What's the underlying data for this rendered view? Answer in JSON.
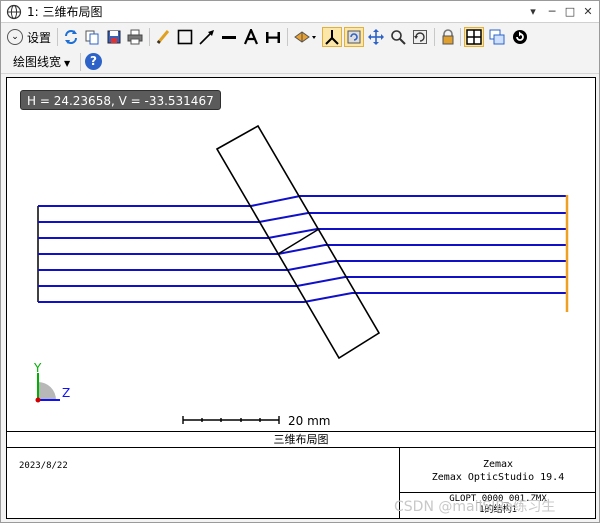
{
  "window": {
    "title": "1: 三维布局图",
    "controls": [
      "▾",
      "□",
      "✕"
    ]
  },
  "toolbar": {
    "settings_label": "设置",
    "line_width_label": "绘图线宽"
  },
  "plot": {
    "coordinate_readout": "H = 24.23658, V = -33.531467",
    "scale_label": "20 mm",
    "axis_labels": {
      "y": "Y",
      "z": "Z"
    },
    "colors": {
      "rays": "#1010c8",
      "lens": "#000000",
      "image_plane": "#f0a020",
      "axis_y": "#00b000",
      "axis_z": "#1010ff"
    }
  },
  "footer": {
    "plot_title": "三维布局图",
    "date": "2023/8/22",
    "brand": "Zemax",
    "product": "Zemax OpticStudio 19.4",
    "file_name": "GLOPT_0000_001.ZMX",
    "configuration": "1的结构1"
  },
  "watermark": "CSDN @mailSIRa练习生"
}
